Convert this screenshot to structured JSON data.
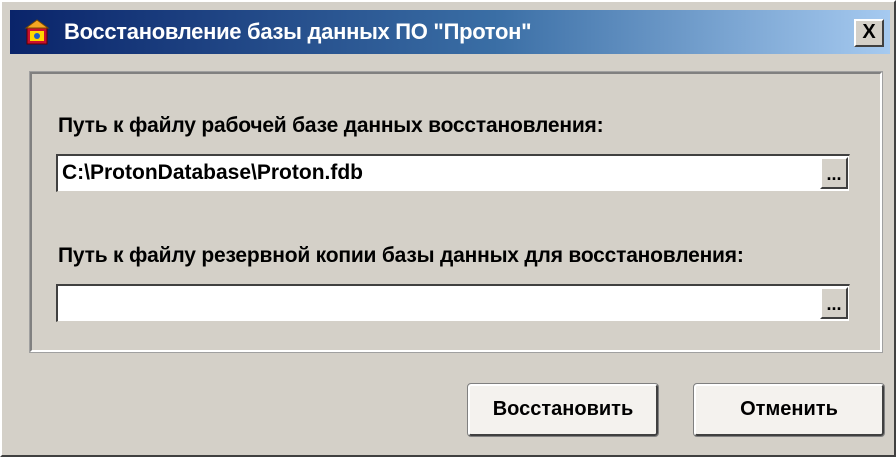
{
  "window": {
    "title": "Восстановление базы данных ПО \"Протон\"",
    "close_glyph": "X",
    "icon": "app-icon"
  },
  "form": {
    "working_db_label": "Путь к файлу рабочей базе данных восстановления:",
    "working_db_value": "C:\\ProtonDatabase\\Proton.fdb",
    "backup_label": "Путь к файлу резервной копии базы данных для восстановления:",
    "backup_value": "",
    "browse_label": "..."
  },
  "buttons": {
    "restore_label": "Восстановить",
    "cancel_label": "Отменить"
  },
  "colors": {
    "title_gradient_start": "#0a246a",
    "title_gradient_end": "#a6caf0",
    "window_bg": "#d4d0c8"
  }
}
